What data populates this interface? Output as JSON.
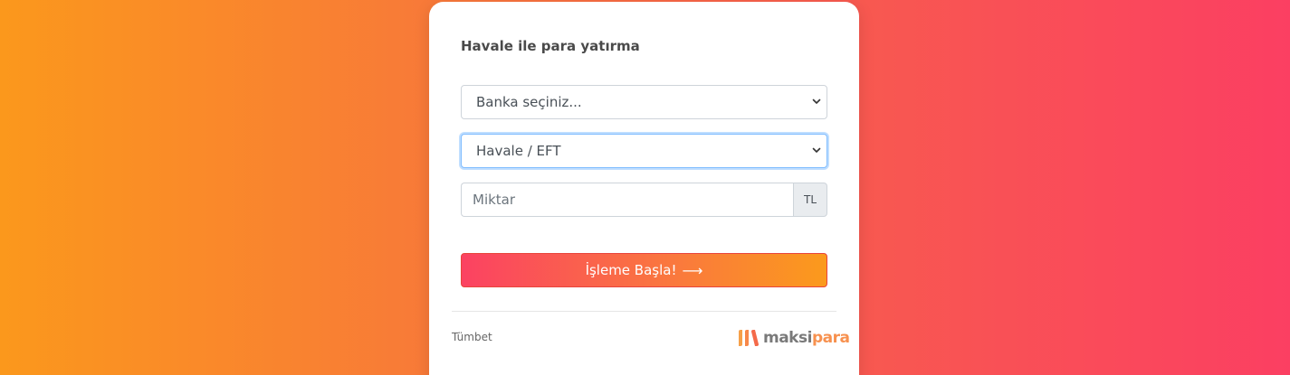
{
  "form": {
    "title": "Havale ile para yatırma",
    "bank_select_value": "Banka seçiniz...",
    "method_select_value": "Havale / EFT",
    "amount_placeholder": "Miktar",
    "currency": "TL",
    "submit_label": "İşleme Başla!",
    "submit_arrow": "⟶"
  },
  "footer": {
    "text": "Tümbet",
    "brand_prefix": "maksi",
    "brand_suffix": "para"
  },
  "colors": {
    "gradient_start": "#fb981c",
    "gradient_end": "#fb3f62",
    "brand_accent": "#f7914f"
  }
}
